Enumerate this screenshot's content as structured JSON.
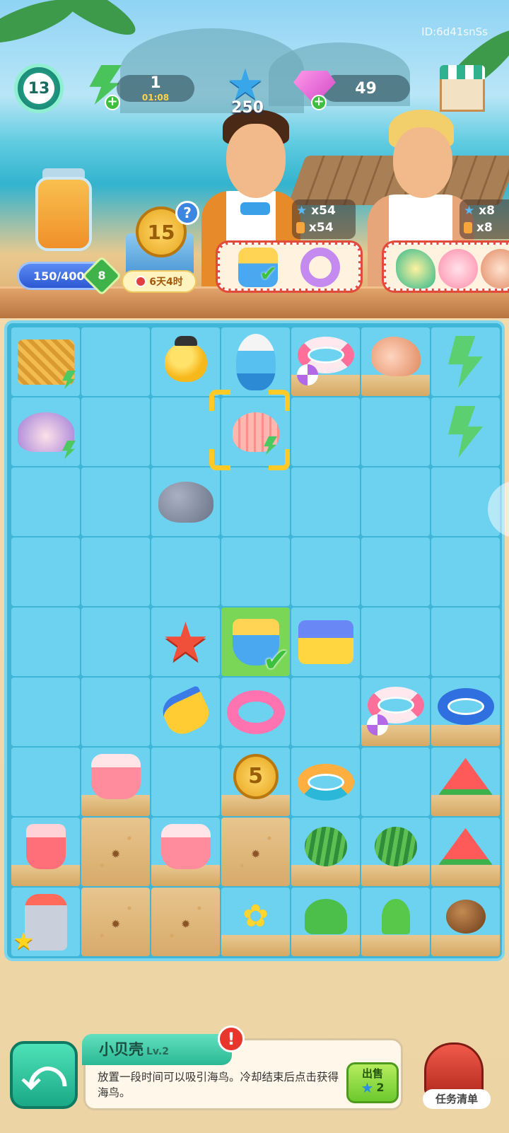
{
  "hud": {
    "user_id": "ID:6d41snSs",
    "level": "13",
    "energy": {
      "count": "1",
      "timer": "01:08"
    },
    "stars": "250",
    "gems": "49"
  },
  "jar": {
    "progress_text": "150/400",
    "level": "8"
  },
  "event": {
    "coin_value": "15",
    "timer": "6天4时"
  },
  "orders": [
    {
      "star_count": "x54",
      "drink_count": "x54",
      "items": [
        "sand-bucket-icon",
        "swim-ring-icon"
      ],
      "completed": [
        true,
        false
      ]
    },
    {
      "star_count": "x8",
      "drink_count": "x8",
      "items": [
        "conch-shell-icon",
        "pink-shell-icon",
        "shell-icon"
      ]
    }
  ],
  "board": {
    "rows": 9,
    "cols": 7,
    "cells": [
      [
        "basket",
        "",
        "duck",
        "parrot",
        "ring-pink",
        "conch",
        "energy"
      ],
      [
        "coral",
        "",
        "",
        "shell-selected",
        "",
        "",
        "energy"
      ],
      [
        "",
        "",
        "rock",
        "",
        "",
        "",
        ""
      ],
      [
        "",
        "",
        "",
        "",
        "",
        "",
        ""
      ],
      [
        "",
        "",
        "starfish",
        "bucket-check",
        "truck",
        "",
        ""
      ],
      [
        "",
        "",
        "shovel",
        "flamingo",
        "",
        "ring-pink",
        "ring-blue"
      ],
      [
        "",
        "drink",
        "",
        "coin5",
        "ring-orange",
        "",
        "melon-slice"
      ],
      [
        "drink-glass",
        "sand",
        "pitcher",
        "sand",
        "melon",
        "melon-plate",
        "melon-plate"
      ],
      [
        "juicer",
        "sand",
        "sand",
        "flower",
        "plant",
        "sprout",
        "seed"
      ]
    ],
    "coin_value": "5"
  },
  "info": {
    "title": "小贝壳",
    "level": "Lv.2",
    "alert": "!",
    "description": "放置一段时间可以吸引海鸟。冷却结束后点击获得海鸟。",
    "sell_label": "出售",
    "sell_price": "2"
  },
  "tasks_label": "任务清单",
  "help_label": "?",
  "back_label": "⤺"
}
